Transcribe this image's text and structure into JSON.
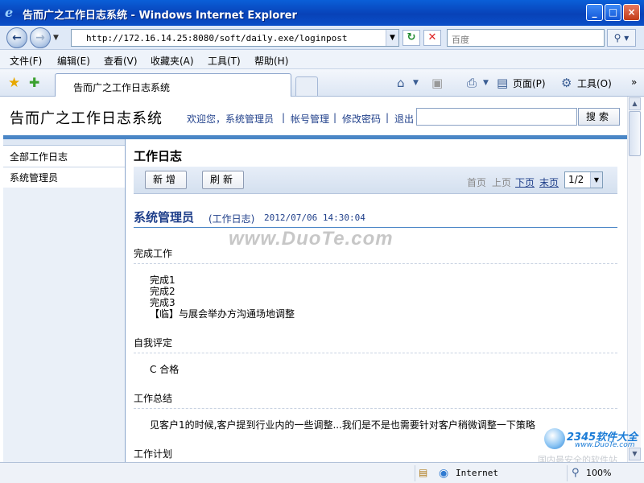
{
  "window": {
    "title": "告而广之工作日志系统 - Windows Internet Explorer",
    "btn_min": "_",
    "btn_max": "□",
    "btn_close": "×"
  },
  "addressbar": {
    "url": "http://172.16.14.25:8080/soft/daily.exe/loginpost",
    "search_placeholder": "百度"
  },
  "menu": [
    "文件(F)",
    "编辑(E)",
    "查看(V)",
    "收藏夹(A)",
    "工具(T)",
    "帮助(H)"
  ],
  "tab": {
    "label": "告而广之工作日志系统"
  },
  "commands": {
    "page": "页面(P)",
    "tools": "工具(O)"
  },
  "site": {
    "title": "告而广之工作日志系统",
    "welcome": "欢迎您，系统管理员",
    "links": [
      "帐号管理",
      "修改密码",
      "退出"
    ],
    "search_button": "搜索"
  },
  "sidebar": {
    "items": [
      {
        "label": "全部工作日志"
      },
      {
        "label": "系统管理员"
      }
    ]
  },
  "main": {
    "title": "工作日志",
    "buttons": {
      "add": "新增",
      "refresh": "刷新"
    },
    "pager": {
      "first": "首页",
      "prev": "上页",
      "next": "下页",
      "last": "末页",
      "current": "1/2"
    }
  },
  "entry": {
    "author": "系统管理员",
    "type": "(工作日志)",
    "date": "2012/07/06 14:30:04",
    "sections": [
      {
        "title": "完成工作",
        "lines": [
          "完成1",
          "完成2",
          "完成3",
          "【临】与展会举办方沟通场地调整"
        ]
      },
      {
        "title": "自我评定",
        "lines": [
          "C 合格"
        ]
      },
      {
        "title": "工作总结",
        "lines": [
          "见客户1的时候,客户提到行业内的一些调整...我们是不是也需要针对客户稍微调整一下策略"
        ]
      },
      {
        "title": "工作计划",
        "lines": []
      }
    ]
  },
  "watermark": "www.DuoTe.com",
  "statusbar": {
    "zone": "Internet",
    "zoom": "100%"
  },
  "corner_logo": {
    "line1": "2345软件大全",
    "line2": "www.DuoTe.com",
    "line3": "国内最安全的软件站"
  }
}
